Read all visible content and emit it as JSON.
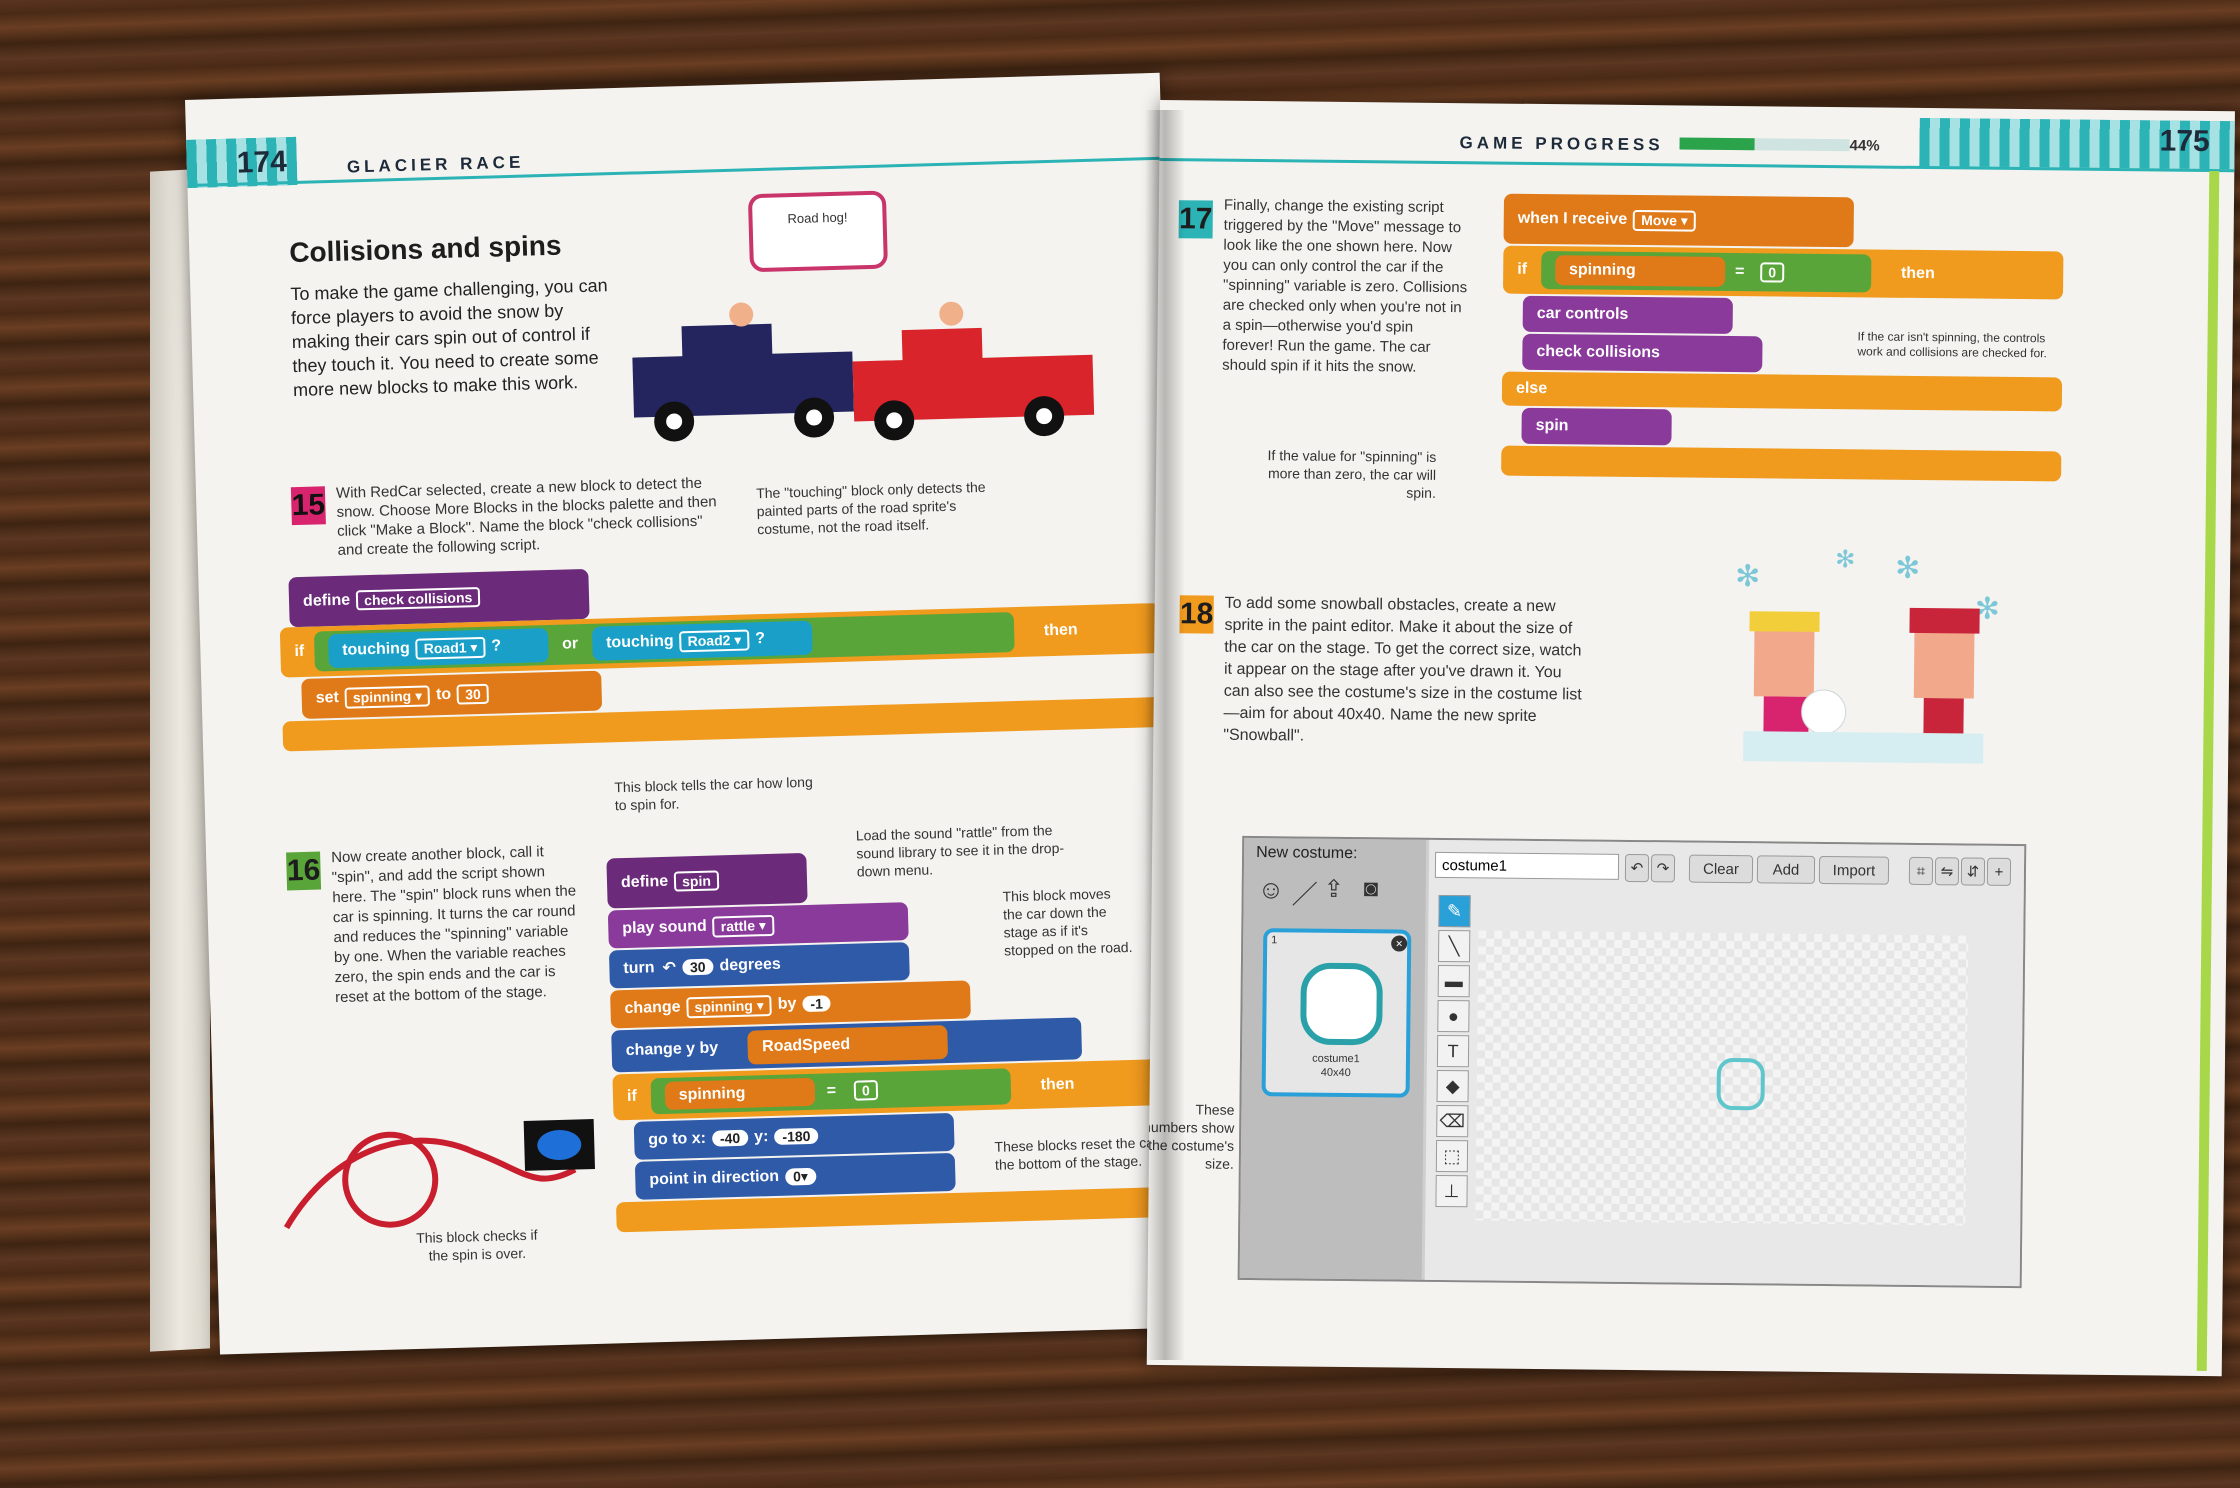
{
  "left_page": {
    "page_number": "174",
    "header": "GLACIER RACE",
    "title": "Collisions and spins",
    "intro": "To make the game challenging, you can force players to avoid the snow by making their cars spin out of control if they touch it. You need to create some more new blocks to make this work.",
    "speech_bubble": "Road hog!",
    "step15": {
      "number": "15",
      "text": "With RedCar selected, create a new block to detect the snow. Choose More Blocks in the blocks palette and then click \"Make a Block\". Name the block \"check collisions\" and create the following script.",
      "note_touching": "The \"touching\" block only detects the painted parts of the road sprite's costume, not the road itself.",
      "note_spin_time": "This block tells the car how long to spin for.",
      "blocks": {
        "define": "define",
        "define_name": "check collisions",
        "if": "if",
        "touching1": "touching",
        "road1": "Road1 ▾",
        "q1": "?",
        "or": "or",
        "touching2": "touching",
        "road2": "Road2 ▾",
        "q2": "?",
        "then": "then",
        "set": "set",
        "var": "spinning ▾",
        "to": "to",
        "value": "30"
      }
    },
    "step16": {
      "number": "16",
      "text": "Now create another block, call it \"spin\", and add the script shown here. The \"spin\" block runs when the car is spinning. It turns the car round and reduces the \"spinning\" variable by one. When the variable reaches zero, the spin ends and the car is reset at the bottom of the stage.",
      "note_sound": "Load the sound \"rattle\" from the sound library to see it in the drop-down menu.",
      "note_move": "This block moves the car down the stage as if it's stopped on the road.",
      "note_reset": "These blocks reset the car at the bottom of the stage.",
      "note_check": "This block checks if the spin is over.",
      "blocks": {
        "define": "define",
        "define_name": "spin",
        "play_sound": "play sound",
        "sound": "rattle ▾",
        "turn": "turn",
        "turn_icon": "↶",
        "degrees_value": "30",
        "degrees": "degrees",
        "change": "change",
        "change_var": "spinning ▾",
        "by": "by",
        "by_value": "-1",
        "change_y": "change y by",
        "road_speed": "RoadSpeed",
        "if": "if",
        "spinning": "spinning",
        "equals": "=",
        "zero": "0",
        "then": "then",
        "goto": "go to x:",
        "x_value": "-40",
        "y_label": "y:",
        "y_value": "-180",
        "point": "point in direction",
        "dir_value": "0▾"
      }
    }
  },
  "right_page": {
    "page_number": "175",
    "header": "GAME PROGRESS",
    "progress_percent": "44%",
    "progress_fraction": 0.44,
    "step17": {
      "number": "17",
      "text": "Finally, change the existing script triggered by the \"Move\" message to look like the one shown here. Now you can only control the car if the \"spinning\" variable is zero. Collisions are checked only when you're not in a spin—otherwise you'd spin forever! Run the game. The car should spin if it hits the snow.",
      "note_spinning": "If the car isn't spinning, the controls work and collisions are checked for.",
      "note_value": "If the value for \"spinning\" is more than zero, the car will spin.",
      "blocks": {
        "when_receive": "when I receive",
        "message": "Move ▾",
        "if": "if",
        "spinning": "spinning",
        "equals": "=",
        "zero": "0",
        "then": "then",
        "car_controls": "car controls",
        "check_collisions": "check collisions",
        "else": "else",
        "spin": "spin"
      }
    },
    "step18": {
      "number": "18",
      "text": "To add some snowball obstacles, create a new sprite in the paint editor. Make it about the size of the car on the stage. To get the correct size, watch it appear on the stage after you've drawn it. You can also see the costume's size in the costume list—aim for about 40x40. Name the new sprite \"Snowball\"."
    },
    "editor": {
      "new_costume": "New costume:",
      "costume_name": "costume1",
      "clear": "Clear",
      "add": "Add",
      "import": "Import",
      "thumb_index": "1",
      "thumb_name": "costume1",
      "thumb_size": "40x40",
      "note_numbers": "These numbers show the costume's size."
    }
  }
}
